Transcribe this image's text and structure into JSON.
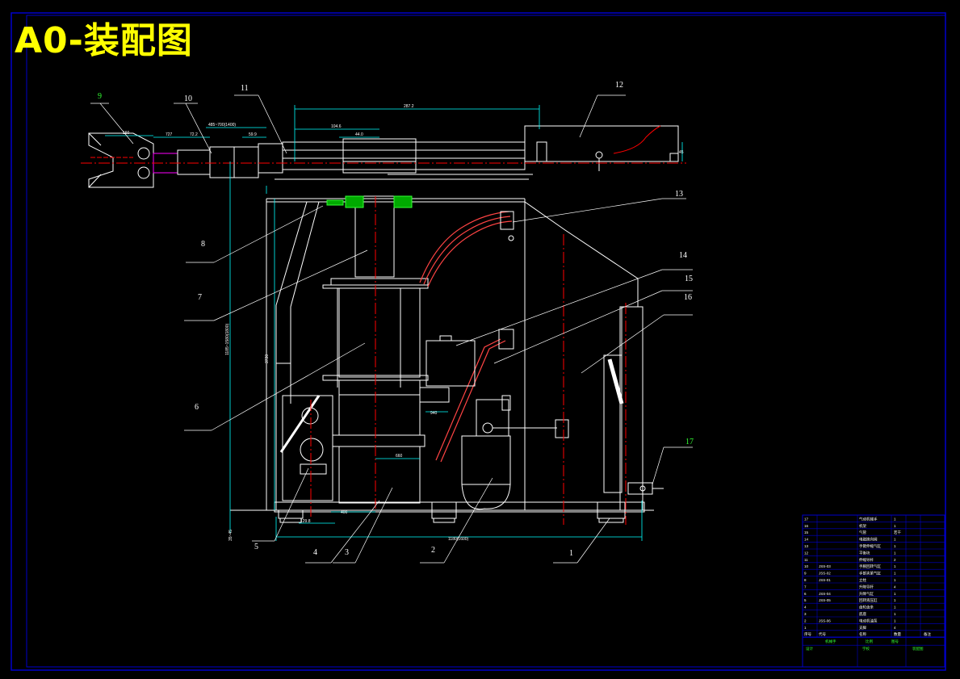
{
  "title": "A0-装配图",
  "callouts": {
    "n1": "1",
    "n2": "2",
    "n3": "3",
    "n4": "4",
    "n5": "5",
    "n6": "6",
    "n7": "7",
    "n8": "8",
    "n9": "9",
    "n10": "10",
    "n11": "11",
    "n12": "12",
    "n13": "13",
    "n14": "14",
    "n15": "15",
    "n16": "16",
    "n17": "17"
  },
  "dimensions": {
    "d_top": "287.2",
    "d_104": "104.6",
    "d_44": "44.0",
    "d_160": "160",
    "d_727": "727",
    "d_722": "72.2",
    "d_range": "485~700(1400)",
    "d_59": "59.9",
    "d_side_v": "1185~1580(1800)",
    "d_3730": "3730",
    "d_940": "940",
    "d_660": "660",
    "d_400": "400",
    "d_129": "129.8",
    "d_base": "1180(1600)",
    "d_40": "45",
    "d_8": "8",
    "d_left_v": "35~45"
  },
  "bom": {
    "rows": [
      {
        "no": "17",
        "code": "",
        "name": "气动机械手",
        "qty": "1"
      },
      {
        "no": "16",
        "code": "",
        "name": "机架",
        "qty": "1"
      },
      {
        "no": "15",
        "code": "",
        "name": "气管",
        "qty": "若干"
      },
      {
        "no": "14",
        "code": "",
        "name": "电磁换向阀",
        "qty": "1"
      },
      {
        "no": "13",
        "code": "",
        "name": "手臂伸缩气缸",
        "qty": "1"
      },
      {
        "no": "12",
        "code": "",
        "name": "平衡块",
        "qty": "1"
      },
      {
        "no": "11",
        "code": "",
        "name": "伸缩导杆",
        "qty": "2"
      },
      {
        "no": "10",
        "code": "JSS-03",
        "name": "手腕回转气缸",
        "qty": "1"
      },
      {
        "no": "9",
        "code": "JSS-02",
        "name": "手部夹紧气缸",
        "qty": "1"
      },
      {
        "no": "8",
        "code": "JSS-01",
        "name": "立柱",
        "qty": "1"
      },
      {
        "no": "7",
        "code": "",
        "name": "升降导杆",
        "qty": "4"
      },
      {
        "no": "6",
        "code": "JSS-04",
        "name": "升降气缸",
        "qty": "1"
      },
      {
        "no": "5",
        "code": "JSS-05",
        "name": "回转液压缸",
        "qty": "1"
      },
      {
        "no": "4",
        "code": "",
        "name": "齿轮齿条",
        "qty": "1"
      },
      {
        "no": "3",
        "code": "",
        "name": "底座",
        "qty": "1"
      },
      {
        "no": "2",
        "code": "JSS-06",
        "name": "电动机油泵",
        "qty": "1"
      },
      {
        "no": "1",
        "code": "",
        "name": "支脚",
        "qty": "4"
      }
    ],
    "header": {
      "no": "序号",
      "code": "代号",
      "name": "名称",
      "qty": "数量",
      "note": "备注"
    },
    "title_block": {
      "project": "机械手",
      "scale": "比例",
      "sheet": "图号",
      "designer": "设计",
      "school": "学校",
      "drawing": "装配图"
    }
  },
  "colors": {
    "frame": "#0000cc",
    "line": "#ffffff",
    "cyan": "#00ffff",
    "red": "#ff0000",
    "yellow": "#ffff00",
    "green": "#33ff33",
    "magenta": "#ff00ff"
  }
}
